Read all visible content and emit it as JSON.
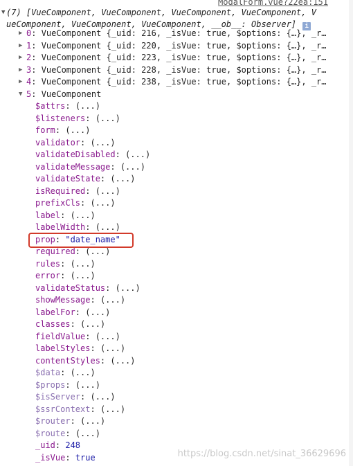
{
  "source_link": "ModalForm.vue?22ea:151",
  "header": {
    "line1": "(7) [VueComponent, VueComponent, VueComponent, VueComponent, V",
    "line2": "ueComponent, VueComponent, VueComponent, __ob__: Observer]",
    "info_glyph": "i"
  },
  "array_items": [
    {
      "index": "0",
      "text": "VueComponent {_uid: 216, _isVue: true, $options: {…}, _r…"
    },
    {
      "index": "1",
      "text": "VueComponent {_uid: 220, _isVue: true, $options: {…}, _r…"
    },
    {
      "index": "2",
      "text": "VueComponent {_uid: 223, _isVue: true, $options: {…}, _r…"
    },
    {
      "index": "3",
      "text": "VueComponent {_uid: 228, _isVue: true, $options: {…}, _r…"
    },
    {
      "index": "4",
      "text": "VueComponent {_uid: 238, _isVue: true, $options: {…}, _r…"
    }
  ],
  "expanded": {
    "index": "5",
    "text": "VueComponent"
  },
  "properties": [
    {
      "key": "$attrs",
      "val": "(...)"
    },
    {
      "key": "$listeners",
      "val": "(...)"
    },
    {
      "key": "form",
      "val": "(...)"
    },
    {
      "key": "validator",
      "val": "(...)"
    },
    {
      "key": "validateDisabled",
      "val": "(...)"
    },
    {
      "key": "validateMessage",
      "val": "(...)"
    },
    {
      "key": "validateState",
      "val": "(...)"
    },
    {
      "key": "isRequired",
      "val": "(...)"
    },
    {
      "key": "prefixCls",
      "val": "(...)"
    },
    {
      "key": "label",
      "val": "(...)"
    },
    {
      "key": "labelWidth",
      "val": "(...)"
    },
    {
      "key": "prop",
      "val": "\"date_name\""
    },
    {
      "key": "required",
      "val": "(...)"
    },
    {
      "key": "rules",
      "val": "(...)"
    },
    {
      "key": "error",
      "val": "(...)"
    },
    {
      "key": "validateStatus",
      "val": "(...)"
    },
    {
      "key": "showMessage",
      "val": "(...)"
    },
    {
      "key": "labelFor",
      "val": "(...)"
    },
    {
      "key": "classes",
      "val": "(...)"
    },
    {
      "key": "fieldValue",
      "val": "(...)"
    },
    {
      "key": "labelStyles",
      "val": "(...)"
    },
    {
      "key": "contentStyles",
      "val": "(...)"
    },
    {
      "key": "$data",
      "val": "(...)"
    },
    {
      "key": "$props",
      "val": "(...)"
    },
    {
      "key": "$isServer",
      "val": "(...)"
    },
    {
      "key": "$ssrContext",
      "val": "(...)"
    },
    {
      "key": "$router",
      "val": "(...)"
    },
    {
      "key": "$route",
      "val": "(...)"
    },
    {
      "key": "_uid",
      "val": "248"
    },
    {
      "key": "_isVue",
      "val": "true"
    }
  ],
  "watermark": "https://blog.csdn.net/sinat_36629696"
}
